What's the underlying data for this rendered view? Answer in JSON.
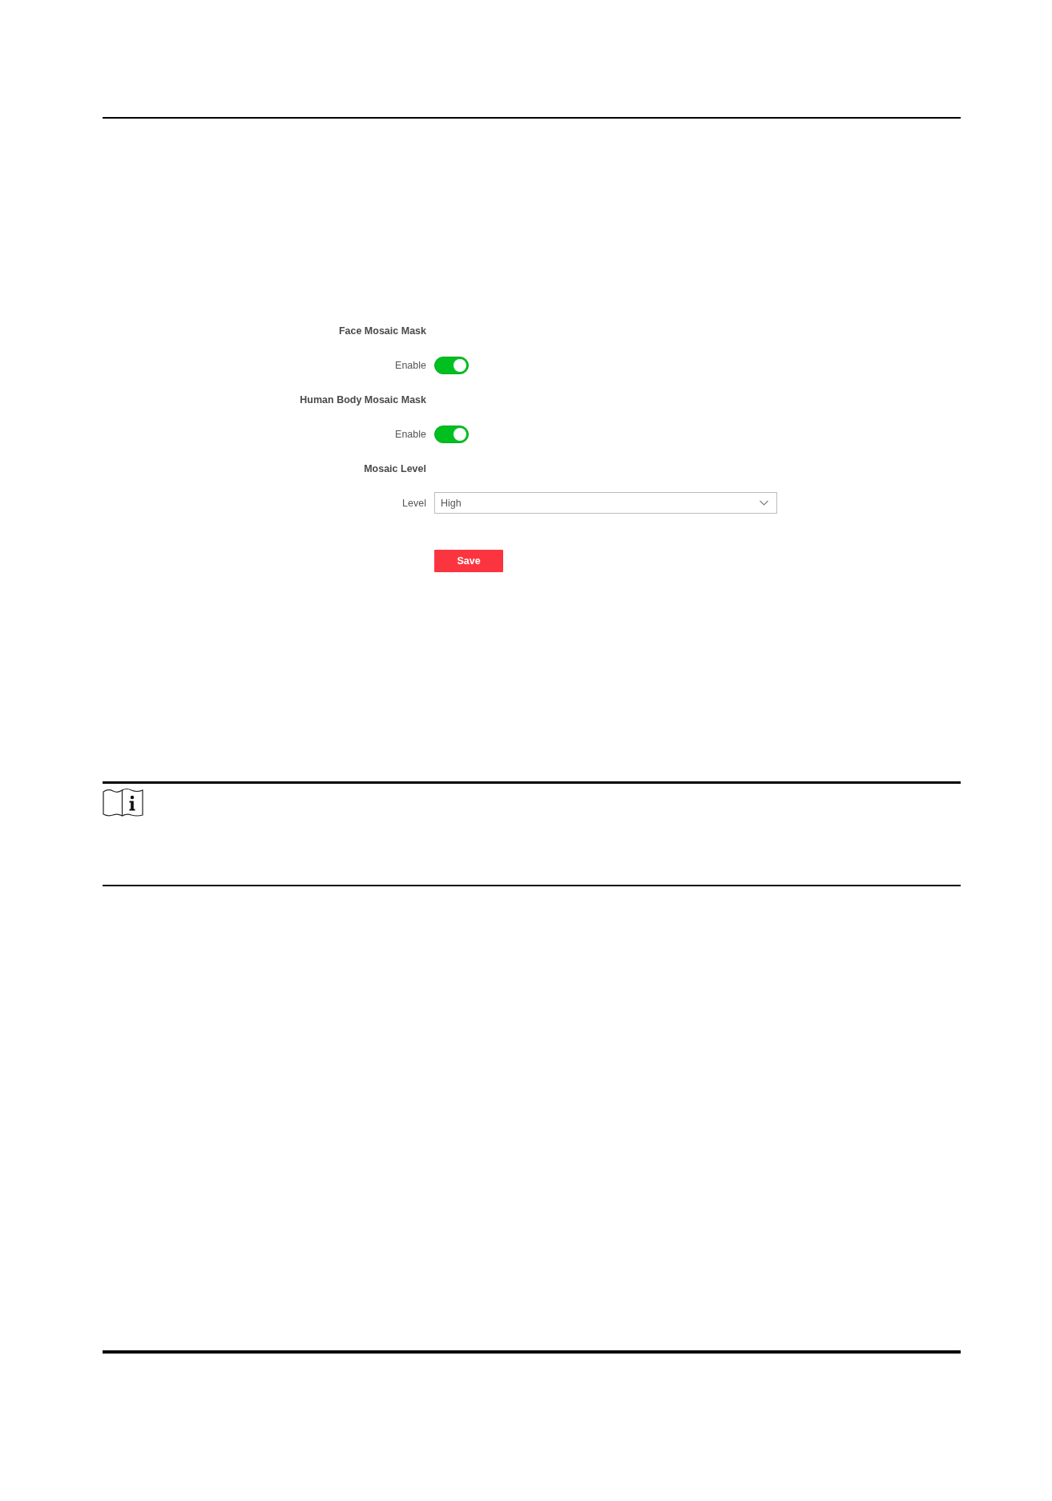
{
  "form": {
    "rows": [
      {
        "kind": "heading",
        "label": "Face Mosaic Mask"
      },
      {
        "kind": "toggle",
        "label": "Enable",
        "on": true
      },
      {
        "kind": "heading",
        "label": "Human Body Mosaic Mask"
      },
      {
        "kind": "toggle",
        "label": "Enable",
        "on": true
      },
      {
        "kind": "heading",
        "label": "Mosaic Level"
      },
      {
        "kind": "select",
        "label": "Level",
        "value": "High"
      }
    ],
    "save_button": "Save"
  }
}
